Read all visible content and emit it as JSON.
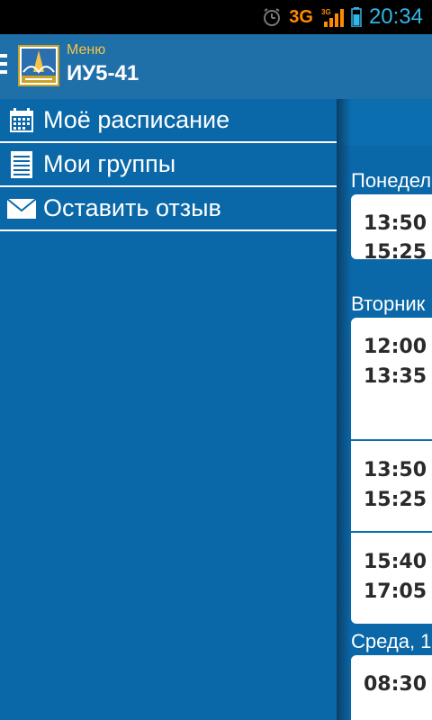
{
  "status_bar": {
    "network": "3G",
    "time": "20:34",
    "icons": [
      "alarm-icon",
      "signal-icon",
      "battery-icon"
    ],
    "time_color": "#33b5e5",
    "network_color": "#ff8a00"
  },
  "action_bar": {
    "subtitle": "Меню",
    "title": "ИУ5-41",
    "color": "#1f6fa9"
  },
  "drawer": {
    "items": [
      {
        "label": "Моё расписание",
        "icon": "calendar-icon"
      },
      {
        "label": "Мои группы",
        "icon": "list-icon"
      },
      {
        "label": "Оставить отзыв",
        "icon": "mail-icon"
      }
    ],
    "color": "#0a68a8"
  },
  "schedule": {
    "days": [
      {
        "label": "Понедел",
        "slots": [
          {
            "start": "13:50",
            "end": "15:25"
          }
        ]
      },
      {
        "label": "Вторник",
        "slots": [
          {
            "start": "12:00",
            "end": "13:35"
          },
          {
            "start": "13:50",
            "end": "15:25"
          },
          {
            "start": "15:40",
            "end": "17:05"
          }
        ]
      },
      {
        "label": "Среда, 1",
        "slots": [
          {
            "start": "08:30",
            "end": ""
          }
        ]
      }
    ]
  }
}
